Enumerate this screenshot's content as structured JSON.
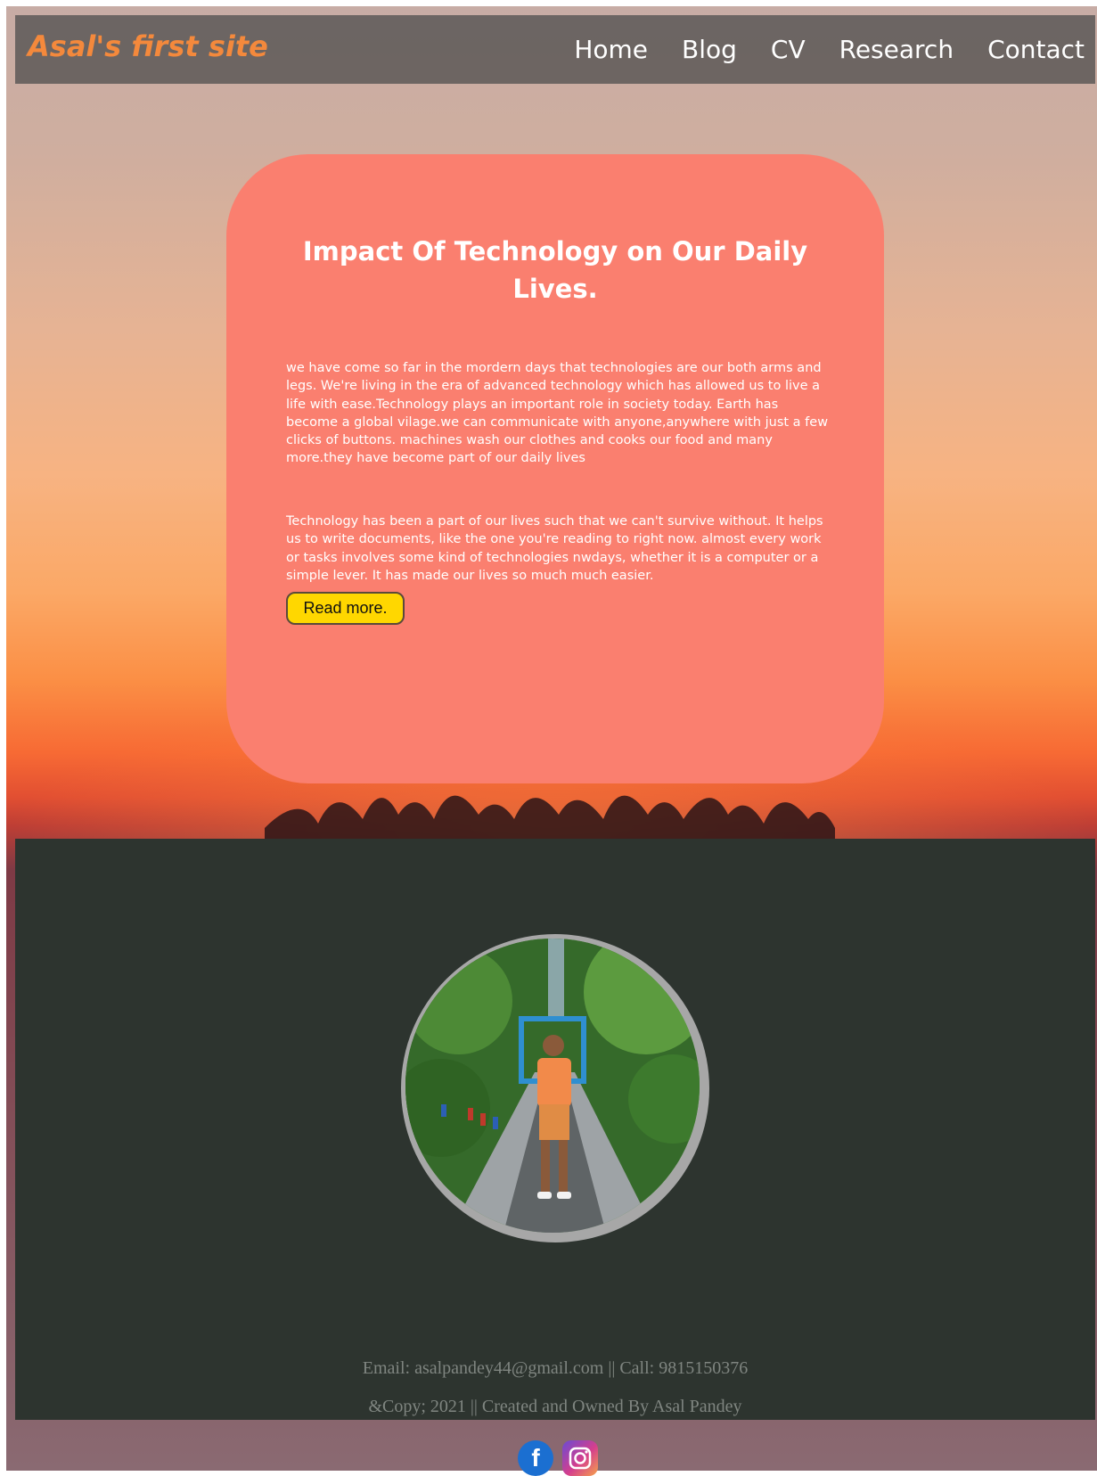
{
  "site": {
    "brand": "Asal's first site",
    "nav": [
      "Home",
      "Blog",
      "CV",
      "Research",
      "Contact"
    ]
  },
  "article": {
    "title": "Impact Of Technology on Our Daily Lives.",
    "paragraph1": "we have come so far in the mordern days that technologies are our both arms and legs. We're living in the era of advanced technology which has allowed us to live a life with ease.Technology plays an important role in society today. Earth has become a global vilage.we can communicate with anyone,anywhere with just a few clicks of buttons. machines wash our clothes and cooks our food and many more.they have become part of our daily lives",
    "paragraph2": "Technology has been a part of our lives such that we can't survive without. It helps us to write documents, like the one you're reading to right now. almost every work or tasks involves some kind of technologies nwdays, whether it is a computer or a simple lever. It has made our lives so much much easier.",
    "read_more": "Read more."
  },
  "footer": {
    "contact": "Email: asalpandey44@gmail.com || Call: 9815150376",
    "copyright": "&Copy; 2021 || Created and Owned By Asal Pandey"
  },
  "social": {
    "icons": [
      "facebook-icon",
      "instagram-icon"
    ],
    "facebook_glyph": "f"
  },
  "colors": {
    "brand": "#f4893c",
    "card": "#fa7f6f",
    "button": "#ffd700",
    "footer_bg": "#2d342f",
    "navbar_bg": "#585554"
  }
}
